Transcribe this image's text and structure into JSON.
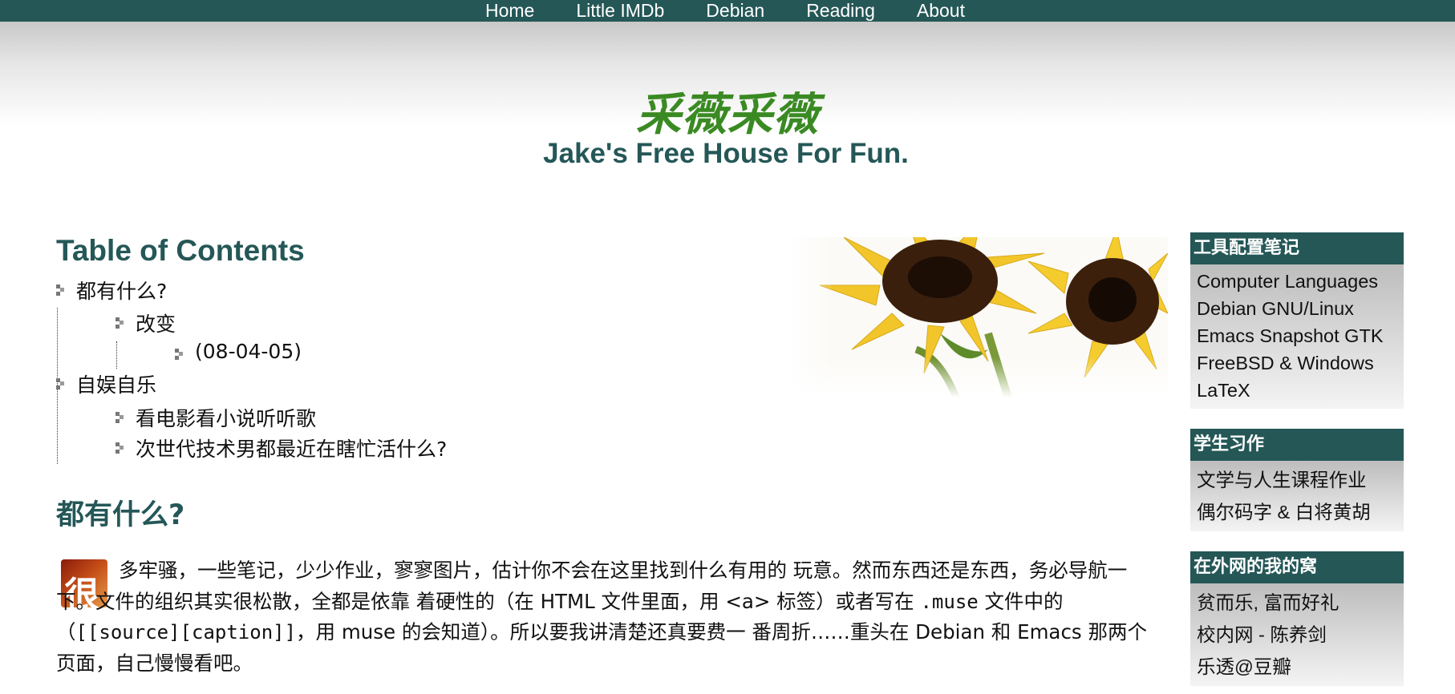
{
  "nav": {
    "items": [
      "Home",
      "Little IMDb",
      "Debian",
      "Reading",
      "About"
    ]
  },
  "header": {
    "title": "采薇采薇",
    "subtitle": "Jake's Free House For Fun."
  },
  "toc": {
    "title": "Table of Contents",
    "items": [
      "都有什么?",
      "改变",
      "(08-04-05)",
      "自娱自乐",
      "看电影看小说听听歌",
      "次世代技术男都最近在瞎忙活什么?"
    ]
  },
  "section": {
    "title": "都有什么?",
    "dropcap_char": "很",
    "para": {
      "a": "多牢骚，一些笔记，少少作业，寥寥图片，估计你不会在这里找到什么有用的 玩意。然而东西还是东西，务必导航一下。文件的组织其实很松散，全都是依靠 着硬性的（在 HTML 文件里面，用 <a> 标签）或者写在 ",
      "code1": ".muse",
      "b": " 文件中的 （",
      "code2": "[[source][caption]]",
      "c": "，用 muse 的会知道）。所以要我讲清楚还真要费一 番周折……重头在 Debian 和 Emacs 那两个页面，自己慢慢看吧。"
    }
  },
  "sidebar": {
    "boxes": [
      {
        "title": "工具配置笔记",
        "items": [
          "Computer Languages",
          "Debian GNU/Linux",
          "Emacs Snapshot GTK",
          "FreeBSD & Windows",
          "LaTeX"
        ]
      },
      {
        "title": "学生习作",
        "items": [
          "文学与人生课程作业",
          "偶尔码字 & 白将黄胡"
        ]
      },
      {
        "title": "在外网的我的窝",
        "items": [
          "贫而乐, 富而好礼",
          "校内网 - 陈养剑",
          "乐透@豆瓣"
        ]
      }
    ]
  },
  "colors": {
    "nav_bg": "#255757",
    "title_green": "#3a8a23",
    "heading_teal": "#255757"
  }
}
